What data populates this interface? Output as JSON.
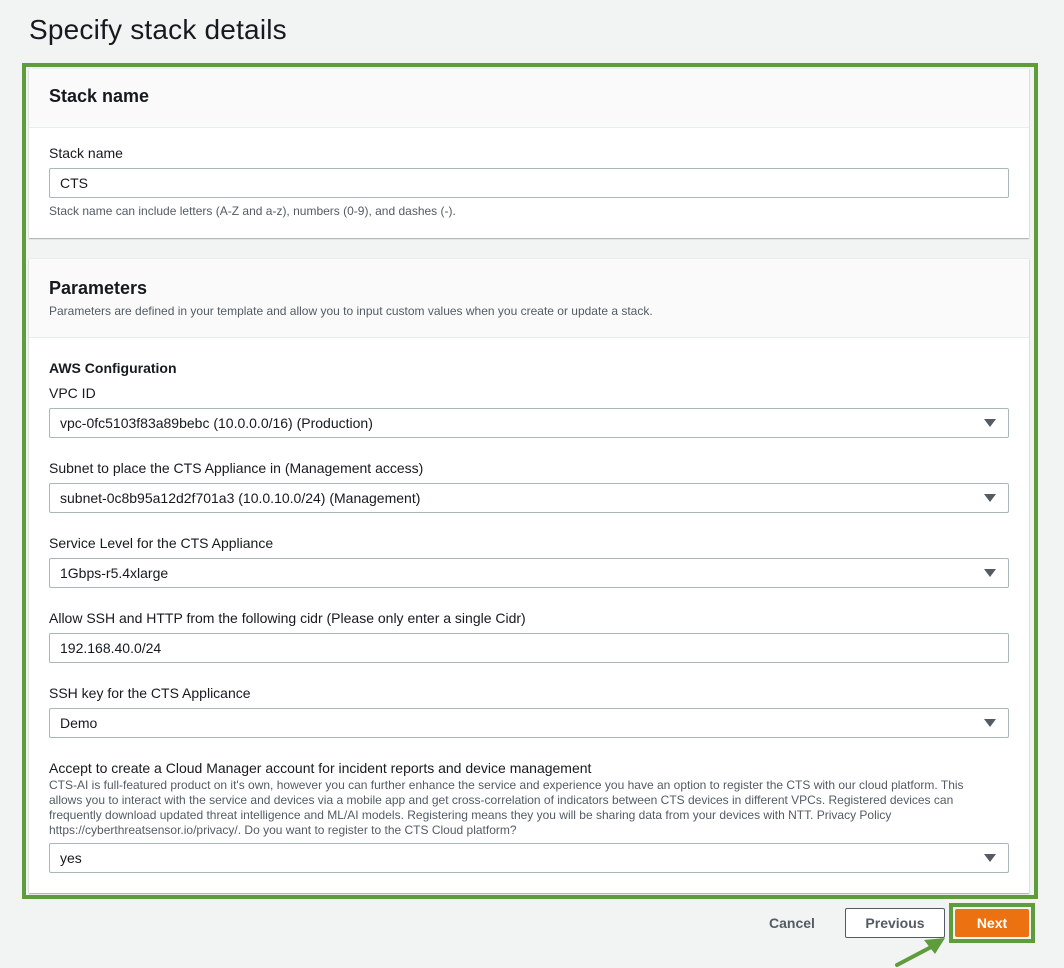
{
  "page": {
    "title": "Specify stack details"
  },
  "stack_name": {
    "section_title": "Stack name",
    "label": "Stack name",
    "value": "CTS",
    "hint": "Stack name can include letters (A-Z and a-z), numbers (0-9), and dashes (-)."
  },
  "parameters": {
    "section_title": "Parameters",
    "description": "Parameters are defined in your template and allow you to input custom values when you create or update a stack.",
    "group_title": "AWS Configuration",
    "vpc": {
      "label": "VPC ID",
      "value": "vpc-0fc5103f83a89bebc (10.0.0.0/16) (Production)"
    },
    "subnet": {
      "label": "Subnet to place the CTS Appliance in (Management access)",
      "value": "subnet-0c8b95a12d2f701a3 (10.0.10.0/24) (Management)"
    },
    "service_level": {
      "label": "Service Level for the CTS Appliance",
      "value": "1Gbps-r5.4xlarge"
    },
    "cidr": {
      "label": "Allow SSH and HTTP from the following cidr (Please only enter a single Cidr)",
      "value": "192.168.40.0/24"
    },
    "ssh_key": {
      "label": "SSH key for the CTS Applicance",
      "value": "Demo"
    },
    "cloud_manager": {
      "label": "Accept to create a Cloud Manager account for incident reports and device management",
      "description_lines": [
        "CTS-AI is full-featured product on it's own, however you can further enhance the service and experience you have an option to register the CTS with our cloud platform. This",
        "allows you to interact with the service and devices via a mobile app and get cross-correlation of indicators between CTS devices in different VPCs. Registered devices can",
        "frequently download updated threat intelligence and ML/AI models. Registering means they you will be sharing data from your devices with NTT. Privacy Policy",
        "https://cyberthreatsensor.io/privacy/. Do you want to register to the CTS Cloud platform?"
      ],
      "value": "yes"
    }
  },
  "footer": {
    "cancel": "Cancel",
    "previous": "Previous",
    "next": "Next"
  },
  "colors": {
    "highlight": "#5f9c3c",
    "primary_button": "#ec7211",
    "background": "#f2f3f3"
  }
}
